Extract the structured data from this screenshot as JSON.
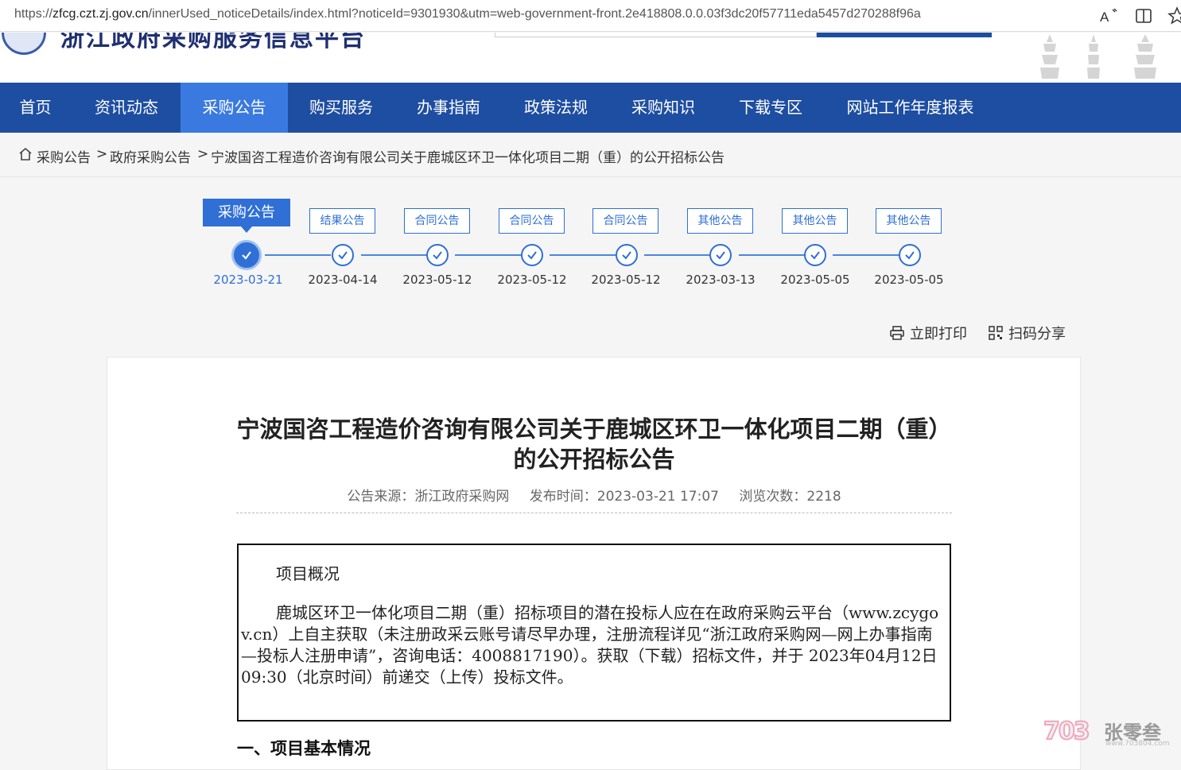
{
  "browser": {
    "url_prefix": "https://",
    "url_host": "zfcg.czt.zj.gov.cn",
    "url_path": "/innerUsed_noticeDetails/index.html?noticeId=9301930&utm=web-government-front.2e418808.0.0.03f3dc20f57711eda5457d270288f96a",
    "icons": [
      "read-aloud-icon",
      "split-screen-icon",
      "favorite-star-icon"
    ]
  },
  "header": {
    "site_name": "浙江政府采购服务信息平台"
  },
  "nav": {
    "items": [
      {
        "label": "首页"
      },
      {
        "label": "资讯动态"
      },
      {
        "label": "采购公告"
      },
      {
        "label": "购买服务"
      },
      {
        "label": "办事指南"
      },
      {
        "label": "政策法规"
      },
      {
        "label": "采购知识"
      },
      {
        "label": "下载专区"
      },
      {
        "label": "网站工作年度报表"
      }
    ],
    "active_index": 2
  },
  "breadcrumb": {
    "items": [
      "采购公告",
      "政府采购公告",
      "宁波国咨工程造价咨询有限公司关于鹿城区环卫一体化项目二期（重）的公开招标公告"
    ],
    "separator": ">"
  },
  "timeline": {
    "steps": [
      {
        "tag": "采购公告",
        "date": "2023-03-21"
      },
      {
        "tag": "结果公告",
        "date": "2023-04-14"
      },
      {
        "tag": "合同公告",
        "date": "2023-05-12"
      },
      {
        "tag": "合同公告",
        "date": "2023-05-12"
      },
      {
        "tag": "合同公告",
        "date": "2023-05-12"
      },
      {
        "tag": "其他公告",
        "date": "2023-03-13"
      },
      {
        "tag": "其他公告",
        "date": "2023-05-05"
      },
      {
        "tag": "其他公告",
        "date": "2023-05-05"
      }
    ],
    "active_index": 0
  },
  "tools": {
    "print_label": "立即打印",
    "share_label": "扫码分享"
  },
  "article": {
    "title": "宁波国咨工程造价咨询有限公司关于鹿城区环卫一体化项目二期（重）的公开招标公告",
    "source": "公告来源：浙江政府采购网",
    "publish_time": "发布时间：2023-03-21 17:07",
    "views": "浏览次数：2218",
    "overview_heading": "项目概况",
    "overview_text": "鹿城区环卫一体化项目二期（重）招标项目的潜在投标人应在在政府采购云平台（www.zcygov.cn）上自主获取（未注册政采云账号请尽早办理，注册流程详见“浙江政府采购网—网上办事指南—投标人注册申请”，咨询电话：4008817190）。获取（下载）招标文件，并于 2023年04月12日 09:30（北京时间）前递交（上传）投标文件。",
    "section1_heading": "一、项目基本情况"
  },
  "watermark": {
    "logo_text": "703",
    "name": "张零叁",
    "domain": "www.703804.com"
  },
  "colors": {
    "nav_bg": "#1e4ea1",
    "nav_active": "#3a7ae0",
    "accent": "#2f6fd6"
  }
}
